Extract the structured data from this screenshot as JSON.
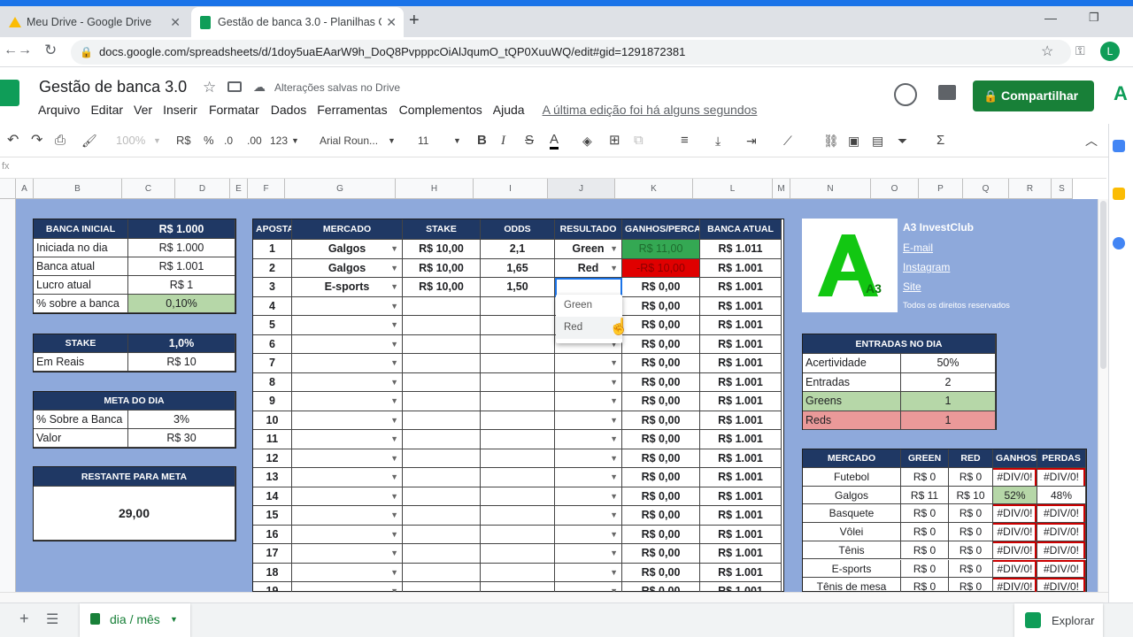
{
  "browser": {
    "tabs": [
      {
        "title": "Meu Drive - Google Drive"
      },
      {
        "title": "Gestão de banca 3.0 - Planilhas G"
      }
    ],
    "url": "docs.google.com/spreadsheets/d/1doy5uaEAarW9h_DoQ8PvpppcOiAlJqumO_tQP0XuuWQ/edit#gid=1291872381",
    "profile_initial": "L"
  },
  "doc": {
    "title": "Gestão de banca 3.0",
    "save_status": "Alterações salvas no Drive",
    "menu": [
      "Arquivo",
      "Editar",
      "Ver",
      "Inserir",
      "Formatar",
      "Dados",
      "Ferramentas",
      "Complementos",
      "Ajuda"
    ],
    "last_edit": "A última edição foi há alguns segundos",
    "share_label": "Compartilhar"
  },
  "toolbar": {
    "zoom": "100%",
    "currency": "R$",
    "percent": "%",
    "dec_less": ".0",
    "dec_more": ".00",
    "number_format": "123",
    "font": "Arial Roun...",
    "font_size": "11"
  },
  "columns": [
    "A",
    "B",
    "C",
    "D",
    "E",
    "F",
    "G",
    "H",
    "I",
    "J",
    "K",
    "L",
    "M",
    "N",
    "O",
    "P",
    "Q",
    "R",
    "S"
  ],
  "banca": {
    "header": [
      "BANCA INICIAL",
      "R$ 1.000"
    ],
    "rows": [
      [
        "Iniciada no dia",
        "R$ 1.000"
      ],
      [
        "Banca atual",
        "R$ 1.001"
      ],
      [
        "Lucro atual",
        "R$ 1"
      ],
      [
        "% sobre a banca",
        "0,10%"
      ]
    ]
  },
  "stake": {
    "header": [
      "STAKE",
      "1,0%"
    ],
    "rows": [
      [
        "Em Reais",
        "R$ 10"
      ]
    ]
  },
  "meta": {
    "header": "META DO DIA",
    "rows": [
      [
        "% Sobre a Banca",
        "3%"
      ],
      [
        "Valor",
        "R$ 30"
      ]
    ]
  },
  "restante": {
    "header": "RESTANTE PARA META",
    "value": "29,00"
  },
  "apostas": {
    "headers": [
      "APOSTA",
      "MERCADO",
      "STAKE",
      "ODDS",
      "RESULTADO",
      "GANHOS/PERCAS",
      "BANCA ATUAL"
    ],
    "rows": [
      [
        "1",
        "Galgos",
        "R$ 10,00",
        "2,1",
        "Green",
        "R$ 11,00",
        "R$ 1.011"
      ],
      [
        "2",
        "Galgos",
        "R$ 10,00",
        "1,65",
        "Red",
        "-R$ 10,00",
        "R$ 1.001"
      ],
      [
        "3",
        "E-sports",
        "R$ 10,00",
        "1,50",
        "",
        "R$ 0,00",
        "R$ 1.001"
      ],
      [
        "4",
        "",
        "",
        "",
        "",
        "R$ 0,00",
        "R$ 1.001"
      ],
      [
        "5",
        "",
        "",
        "",
        "",
        "R$ 0,00",
        "R$ 1.001"
      ],
      [
        "6",
        "",
        "",
        "",
        "",
        "R$ 0,00",
        "R$ 1.001"
      ],
      [
        "7",
        "",
        "",
        "",
        "",
        "R$ 0,00",
        "R$ 1.001"
      ],
      [
        "8",
        "",
        "",
        "",
        "",
        "R$ 0,00",
        "R$ 1.001"
      ],
      [
        "9",
        "",
        "",
        "",
        "",
        "R$ 0,00",
        "R$ 1.001"
      ],
      [
        "10",
        "",
        "",
        "",
        "",
        "R$ 0,00",
        "R$ 1.001"
      ],
      [
        "11",
        "",
        "",
        "",
        "",
        "R$ 0,00",
        "R$ 1.001"
      ],
      [
        "12",
        "",
        "",
        "",
        "",
        "R$ 0,00",
        "R$ 1.001"
      ],
      [
        "13",
        "",
        "",
        "",
        "",
        "R$ 0,00",
        "R$ 1.001"
      ],
      [
        "14",
        "",
        "",
        "",
        "",
        "R$ 0,00",
        "R$ 1.001"
      ],
      [
        "15",
        "",
        "",
        "",
        "",
        "R$ 0,00",
        "R$ 1.001"
      ],
      [
        "16",
        "",
        "",
        "",
        "",
        "R$ 0,00",
        "R$ 1.001"
      ],
      [
        "17",
        "",
        "",
        "",
        "",
        "R$ 0,00",
        "R$ 1.001"
      ],
      [
        "18",
        "",
        "",
        "",
        "",
        "R$ 0,00",
        "R$ 1.001"
      ],
      [
        "19",
        "",
        "",
        "",
        "",
        "R$ 0,00",
        "R$ 1.001"
      ]
    ]
  },
  "dropdown": {
    "options": [
      "Green",
      "Red"
    ]
  },
  "brand": {
    "name": "A3 InvestClub",
    "links": [
      "E-mail",
      "Instagram",
      "Site"
    ],
    "rights": "Todos os direitos reservados",
    "logo_text": "A3"
  },
  "entradas": {
    "header": "ENTRADAS NO DIA",
    "rows": [
      [
        "Acertividade",
        "50%"
      ],
      [
        "Entradas",
        "2"
      ],
      [
        "Greens",
        "1"
      ],
      [
        "Reds",
        "1"
      ]
    ]
  },
  "mercados": {
    "headers": [
      "MERCADO",
      "GREEN",
      "RED",
      "GANHOS",
      "PERDAS"
    ],
    "rows": [
      [
        "Futebol",
        "R$ 0",
        "R$ 0",
        "#DIV/0!",
        "#DIV/0!"
      ],
      [
        "Galgos",
        "R$ 11",
        "R$ 10",
        "52%",
        "48%"
      ],
      [
        "Basquete",
        "R$ 0",
        "R$ 0",
        "#DIV/0!",
        "#DIV/0!"
      ],
      [
        "Vôlei",
        "R$ 0",
        "R$ 0",
        "#DIV/0!",
        "#DIV/0!"
      ],
      [
        "Tênis",
        "R$ 0",
        "R$ 0",
        "#DIV/0!",
        "#DIV/0!"
      ],
      [
        "E-sports",
        "R$ 0",
        "R$ 0",
        "#DIV/0!",
        "#DIV/0!"
      ],
      [
        "Tênis de mesa",
        "R$ 0",
        "R$ 0",
        "#DIV/0!",
        "#DIV/0!"
      ]
    ]
  },
  "sheet_tab": {
    "name": "dia / mês"
  },
  "explore_label": "Explorar",
  "colors": {
    "brand_green": "#0f9d58",
    "header_navy": "#1f3864",
    "sheet_bg": "#8ea9db",
    "chrome_blue": "#1a73e8"
  }
}
